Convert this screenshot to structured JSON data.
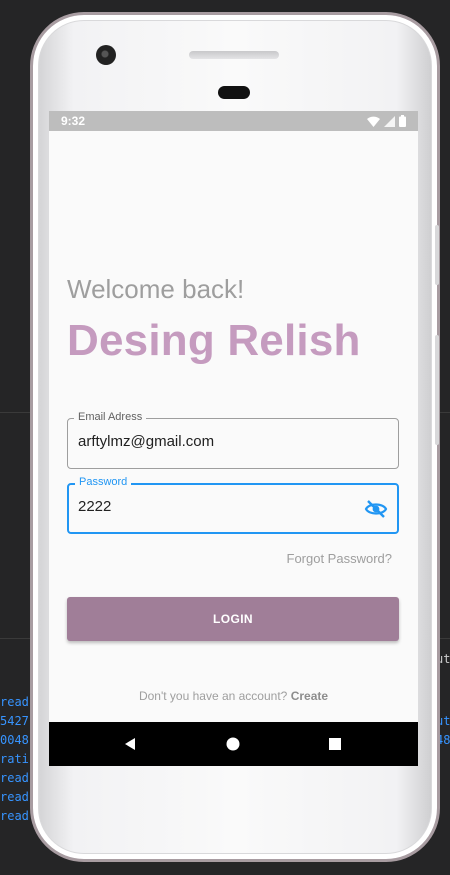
{
  "ide": {
    "left_lines": [
      "read",
      "5427",
      "0048",
      "rati",
      "read",
      "read",
      "read"
    ],
    "right_lines": [
      "ut",
      "ut",
      "48"
    ]
  },
  "status_bar": {
    "time": "9:32",
    "icons": [
      "wifi-icon",
      "signal-icon",
      "battery-icon"
    ]
  },
  "login": {
    "welcome": "Welcome back!",
    "brand": "Desing Relish",
    "email": {
      "label": "Email Adress",
      "value": "arftylmz@gmail.com"
    },
    "password": {
      "label": "Password",
      "value": "2222",
      "toggle_icon": "eye-off-icon"
    },
    "forgot": "Forgot Password?",
    "login_button": "LOGIN",
    "signup_prompt": "Don't you have an account?",
    "signup_link": "Create"
  },
  "nav_bar": {
    "items": [
      "back-icon",
      "home-icon",
      "recents-icon"
    ]
  },
  "colors": {
    "brand": "#c59bbf",
    "button": "#a07e98",
    "focus": "#2196f3",
    "status_bar": "#bdbdbd"
  }
}
